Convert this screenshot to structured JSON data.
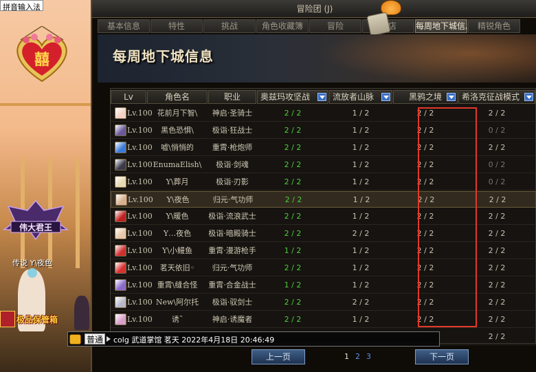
{
  "scene": {
    "ime_text": "拼音输入法",
    "heart_text": "囍",
    "guild_badge_text": "伟大君王",
    "player_label": "传说 Y\\夜色",
    "item_label": "极品保管箱"
  },
  "window": {
    "title": "冒险团 (J)",
    "tabs": [
      "基本信息",
      "特性",
      "挑战",
      "角色收藏簿",
      "冒险",
      "商店",
      "每周地下城信息",
      "精锐角色"
    ],
    "active_tab": "每周地下城信息",
    "banner_title": "每周地下城信息"
  },
  "table": {
    "headers": [
      "Lv",
      "角色名",
      "职业",
      "奥兹玛攻坚战",
      "流放者山脉",
      "黑鸦之境",
      "希洛克征战模式"
    ],
    "rows": [
      {
        "lv": "Lv.100",
        "name": "花前月下智\\",
        "job": "神启·圣骑士",
        "c1": "2 / 2",
        "c2": "1 / 2",
        "c3": "2 / 2",
        "c4": "2 / 2",
        "c4dim": false
      },
      {
        "lv": "Lv.100",
        "name": "黑色恐惧\\",
        "job": "极诣·狂战士",
        "c1": "2 / 2",
        "c2": "1 / 2",
        "c3": "2 / 2",
        "c4": "0 / 2",
        "c4dim": true
      },
      {
        "lv": "Lv.100",
        "name": "嘘\\悄悄的",
        "job": "重霄·枪炮师",
        "c1": "2 / 2",
        "c2": "1 / 2",
        "c3": "2 / 2",
        "c4": "2 / 2",
        "c4dim": false
      },
      {
        "lv": "Lv.100",
        "name": "EnumaElish\\",
        "job": "极诣·剑魂",
        "c1": "2 / 2",
        "c2": "1 / 2",
        "c3": "2 / 2",
        "c4": "0 / 2",
        "c4dim": true
      },
      {
        "lv": "Lv.100",
        "name": "Y\\葬月",
        "job": "极诣·刃影",
        "c1": "2 / 2",
        "c2": "1 / 2",
        "c3": "2 / 2",
        "c4": "0 / 2",
        "c4dim": true
      },
      {
        "lv": "Lv.100",
        "name": "Y\\夜色",
        "job": "归元·气功师",
        "c1": "2 / 2",
        "c2": "1 / 2",
        "c3": "2 / 2",
        "c4": "2 / 2",
        "c4dim": false
      },
      {
        "lv": "Lv.100",
        "name": "Y\\暖色",
        "job": "极诣·流浪武士",
        "c1": "2 / 2",
        "c2": "1 / 2",
        "c3": "2 / 2",
        "c4": "2 / 2",
        "c4dim": false
      },
      {
        "lv": "Lv.100",
        "name": "Y…夜色",
        "job": "极诣·暗殿骑士",
        "c1": "2 / 2",
        "c2": "2 / 2",
        "c3": "2 / 2",
        "c4": "2 / 2",
        "c4dim": false
      },
      {
        "lv": "Lv.100",
        "name": "Y\\小鳗鱼",
        "job": "重霄·漫游枪手",
        "c1": "1 / 2",
        "c2": "1 / 2",
        "c3": "2 / 2",
        "c4": "2 / 2",
        "c4dim": false
      },
      {
        "lv": "Lv.100",
        "name": "茗天依旧◦",
        "job": "归元·气功师",
        "c1": "2 / 2",
        "c2": "1 / 2",
        "c3": "2 / 2",
        "c4": "2 / 2",
        "c4dim": false
      },
      {
        "lv": "Lv.100",
        "name": "重霄\\缝合怪",
        "job": "重霄·合金战士",
        "c1": "1 / 2",
        "c2": "1 / 2",
        "c3": "2 / 2",
        "c4": "2 / 2",
        "c4dim": false
      },
      {
        "lv": "Lv.100",
        "name": "New\\阿尔托",
        "job": "极诣·驭剑士",
        "c1": "2 / 2",
        "c2": "2 / 2",
        "c3": "2 / 2",
        "c4": "2 / 2",
        "c4dim": false
      },
      {
        "lv": "Lv.100",
        "name": "诱˜",
        "job": "神启·诱魔者",
        "c1": "2 / 2",
        "c2": "1 / 2",
        "c3": "2 / 2",
        "c4": "2 / 2",
        "c4dim": false
      },
      {
        "lv": "",
        "name": "",
        "job": "",
        "c1": "",
        "c2": "",
        "c3": "",
        "c4": "2 / 2",
        "c4dim": false
      }
    ],
    "selected_row": 5,
    "avatar_colors": [
      "#f2d2c4",
      "#6a5a9a",
      "#3d7ad6",
      "#3a3a4a",
      "#e8d8b0",
      "#d8b090",
      "#c02020",
      "#e8c8a8",
      "#d03030",
      "#d83030",
      "#8a6ac8",
      "#b8b8c8",
      "#d8a0c8"
    ]
  },
  "chat": {
    "channel": "普通",
    "message": "colg  武道掌馆  茗天  2022年4月18日 20:46:49"
  },
  "pager": {
    "prev": "上一页",
    "next": "下一页",
    "pages": [
      "1",
      "2",
      "3"
    ],
    "current": "1"
  },
  "colors": {
    "highlight_box": "#e23a2a",
    "complete_green": "#4ccf3c"
  }
}
